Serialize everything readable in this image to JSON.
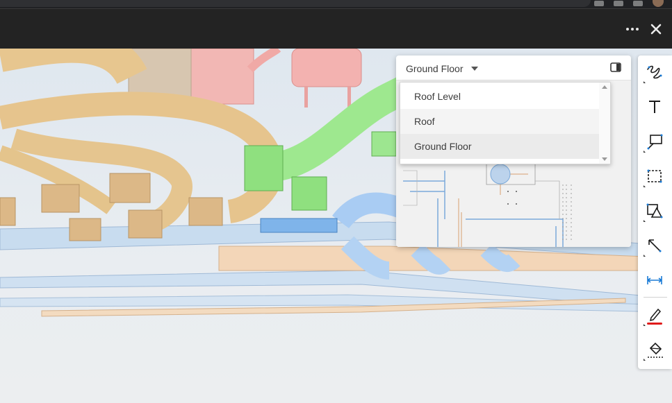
{
  "browser": {
    "tab_strip": ""
  },
  "top_bar": {
    "more_icon": "more-horizontal-icon",
    "close_icon": "close-icon"
  },
  "sheet_panel": {
    "selected_level": "Ground Floor",
    "toggle_icon": "panel-split-icon",
    "dropdown_options": [
      {
        "label": "Roof Level"
      },
      {
        "label": "Roof"
      },
      {
        "label": "Ground Floor"
      }
    ]
  },
  "toolbar": {
    "tools": [
      {
        "name": "freehand-markup-tool",
        "icon": "scribble-icon"
      },
      {
        "name": "text-tool",
        "icon": "text-icon"
      },
      {
        "name": "callout-tool",
        "icon": "callout-icon"
      },
      {
        "name": "rectangle-cloud-tool",
        "icon": "dashed-rectangle-icon"
      },
      {
        "name": "shapes-tool",
        "icon": "shapes-icon"
      },
      {
        "name": "arrow-tool",
        "icon": "arrow-icon"
      },
      {
        "name": "measure-tool",
        "icon": "dimension-icon"
      },
      {
        "name": "pen-color-tool",
        "icon": "pencil-icon"
      },
      {
        "name": "fill-tool",
        "icon": "paint-bucket-icon"
      }
    ],
    "accent_color": "#e01b1b",
    "highlight_color": "#1a7bd6"
  }
}
